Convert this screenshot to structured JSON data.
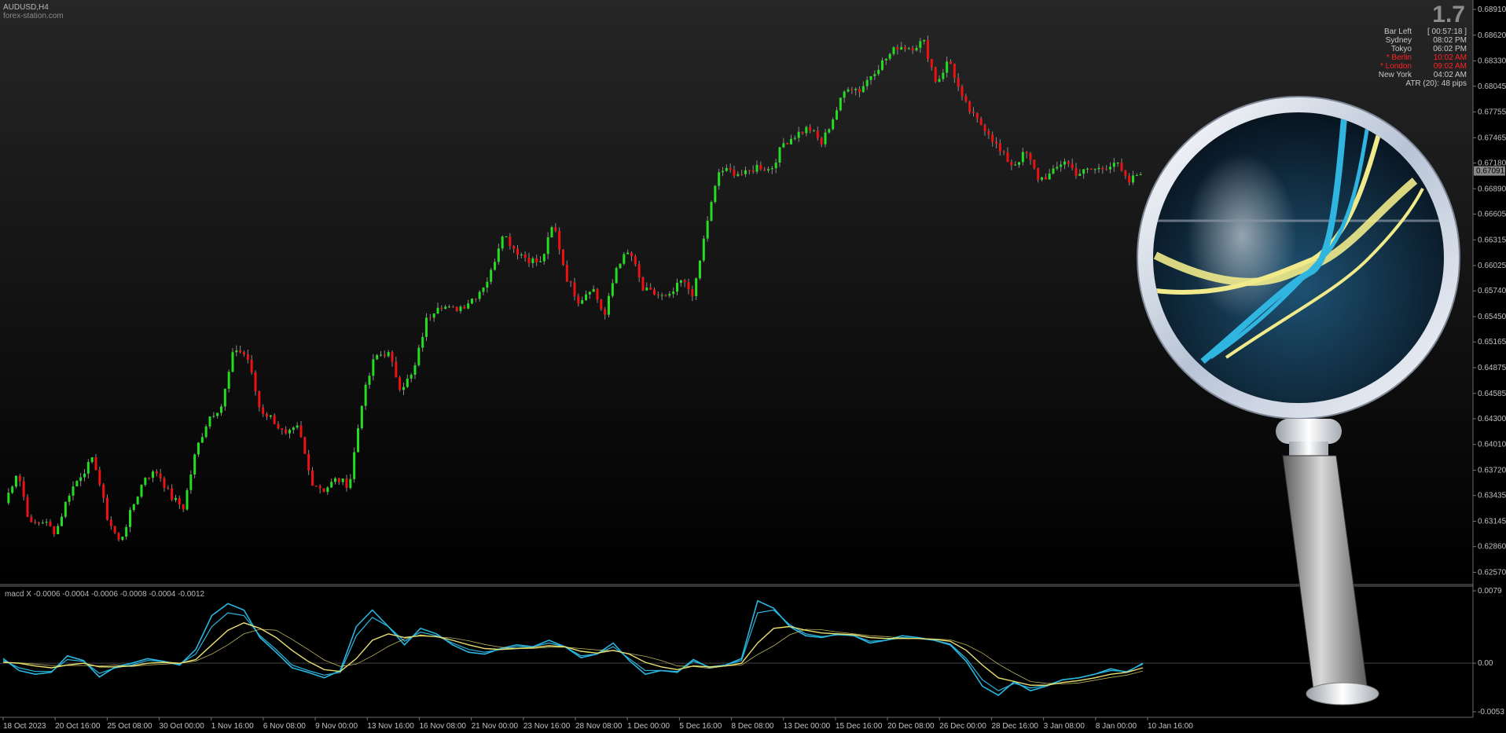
{
  "window": {
    "symbol_label": "AUDUSD,H4",
    "watermark": "forex-station.com"
  },
  "spread_value": "1.7",
  "info_panel": {
    "rows": [
      {
        "label": "Bar Left",
        "value": "[ 00:57:18 ]",
        "highlight": false
      },
      {
        "label": "Sydney",
        "value": "08:02 PM",
        "highlight": false
      },
      {
        "label": "Tokyo",
        "value": "06:02 PM",
        "highlight": false
      },
      {
        "label": "* Berlin",
        "value": "10:02 AM",
        "highlight": true
      },
      {
        "label": "* London",
        "value": "09:02 AM",
        "highlight": true
      },
      {
        "label": "New York",
        "value": "04:02 AM",
        "highlight": false
      }
    ],
    "atr_text": "ATR (20): 48 pips"
  },
  "macd_label": "macd X -0.0006 -0.0004 -0.0006 -0.0008 -0.0004 -0.0012",
  "colors": {
    "bull": "#22dd22",
    "bear": "#ee1111",
    "macd_fast": "#29b6e0",
    "macd_signal": "#e8e070",
    "grid": "#444444",
    "text": "#c0c0c0"
  },
  "chart_data": [
    {
      "type": "candlestick",
      "ylim": [
        0.6253,
        0.6891
      ],
      "y_ticks": [
        "0.68910",
        "0.68620",
        "0.68330",
        "0.68045",
        "0.67755",
        "0.67465",
        "0.67180",
        "0.66890",
        "0.66605",
        "0.66315",
        "0.66025",
        "0.65740",
        "0.65450",
        "0.65165",
        "0.64875",
        "0.64585",
        "0.64300",
        "0.64010",
        "0.63720",
        "0.63435",
        "0.63145",
        "0.62860",
        "0.62570"
      ],
      "current_price": "0.67091",
      "x_ticks": [
        "18 Oct 2023",
        "20 Oct 16:00",
        "25 Oct 08:00",
        "30 Oct 00:00",
        "1 Nov 16:00",
        "6 Nov 08:00",
        "9 Nov 00:00",
        "13 Nov 16:00",
        "16 Nov 08:00",
        "21 Nov 00:00",
        "23 Nov 16:00",
        "28 Nov 08:00",
        "1 Dec 00:00",
        "5 Dec 16:00",
        "8 Dec 08:00",
        "13 Dec 00:00",
        "15 Dec 16:00",
        "20 Dec 08:00",
        "26 Dec 00:00",
        "28 Dec 16:00",
        "3 Jan 08:00",
        "8 Jan 00:00",
        "10 Jan 16:00"
      ],
      "close_path": [
        0.6335,
        0.6372,
        0.631,
        0.6315,
        0.6302,
        0.6345,
        0.6368,
        0.6385,
        0.632,
        0.629,
        0.633,
        0.6365,
        0.637,
        0.6342,
        0.633,
        0.6395,
        0.6432,
        0.6445,
        0.651,
        0.65,
        0.644,
        0.643,
        0.641,
        0.642,
        0.636,
        0.635,
        0.6362,
        0.6355,
        0.645,
        0.65,
        0.6505,
        0.6465,
        0.648,
        0.654,
        0.656,
        0.6552,
        0.6558,
        0.657,
        0.659,
        0.664,
        0.662,
        0.661,
        0.6605,
        0.665,
        0.659,
        0.6562,
        0.658,
        0.6545,
        0.6605,
        0.6618,
        0.6575,
        0.657,
        0.6565,
        0.6585,
        0.657,
        0.665,
        0.671,
        0.6708,
        0.6705,
        0.6715,
        0.671,
        0.674,
        0.675,
        0.6758,
        0.674,
        0.6772,
        0.6805,
        0.68,
        0.682,
        0.6835,
        0.685,
        0.6848,
        0.6855,
        0.6808,
        0.6835,
        0.679,
        0.6768,
        0.6755,
        0.673,
        0.6715,
        0.673,
        0.67,
        0.6705,
        0.6722,
        0.6706,
        0.671,
        0.6712,
        0.672,
        0.6695,
        0.6709
      ]
    },
    {
      "type": "line",
      "title": "macd X",
      "ylim": [
        -0.0053,
        0.0079
      ],
      "y_ticks": [
        "0.0079",
        "0.00",
        "-0.0053"
      ],
      "series": [
        {
          "values": [
            0.0005,
            -0.0008,
            -0.0012,
            -0.001,
            0.0008,
            0.0003,
            -0.0015,
            -0.0004,
            0.0,
            0.0005,
            0.0002,
            -0.0002,
            0.0015,
            0.0052,
            0.0065,
            0.0058,
            0.0028,
            0.0012,
            -0.0005,
            -0.001,
            -0.0016,
            -0.0008,
            0.004,
            0.0058,
            0.004,
            0.002,
            0.0038,
            0.0032,
            0.002,
            0.0012,
            0.001,
            0.0016,
            0.002,
            0.0018,
            0.0025,
            0.0018,
            0.0006,
            0.001,
            0.0022,
            0.0003,
            -0.0012,
            -0.0008,
            -0.001,
            0.0004,
            -0.0005,
            -0.0002,
            0.0005,
            0.0068,
            0.006,
            0.004,
            0.003,
            0.0028,
            0.0032,
            0.003,
            0.0022,
            0.0025,
            0.003,
            0.0028,
            0.0025,
            0.002,
            0.0002,
            -0.0025,
            -0.0035,
            -0.002,
            -0.003,
            -0.0025,
            -0.0018,
            -0.0016,
            -0.0012,
            -0.0006,
            -0.001,
            0.0
          ]
        },
        {
          "values": [
            0.0003,
            -0.0005,
            -0.0009,
            -0.0009,
            0.0004,
            0.0002,
            -0.0011,
            -0.0005,
            -0.0002,
            0.0003,
            0.0002,
            -0.0001,
            0.001,
            0.004,
            0.0055,
            0.0052,
            0.003,
            0.0015,
            -0.0002,
            -0.0008,
            -0.0013,
            -0.001,
            0.003,
            0.005,
            0.004,
            0.0024,
            0.0034,
            0.003,
            0.0022,
            0.0015,
            0.0012,
            0.0015,
            0.0018,
            0.0018,
            0.0022,
            0.0018,
            0.0008,
            0.001,
            0.0018,
            0.0005,
            -0.0008,
            -0.0008,
            -0.0009,
            0.0002,
            -0.0004,
            -0.0002,
            0.0003,
            0.0055,
            0.0058,
            0.0042,
            0.0032,
            0.0029,
            0.0031,
            0.003,
            0.0024,
            0.0025,
            0.0028,
            0.0027,
            0.0025,
            0.0021,
            0.0005,
            -0.0018,
            -0.003,
            -0.0022,
            -0.0027,
            -0.0024,
            -0.0018,
            -0.0016,
            -0.0012,
            -0.0008,
            -0.0009,
            -0.0001
          ]
        },
        {
          "values": [
            0.0001,
            0.0,
            -0.0003,
            -0.0005,
            -0.0002,
            0.0,
            -0.0004,
            -0.0004,
            -0.0003,
            0.0,
            0.0001,
            0.0,
            0.0004,
            0.002,
            0.0036,
            0.0044,
            0.0038,
            0.0028,
            0.0014,
            0.0002,
            -0.0007,
            -0.0009,
            0.0005,
            0.0025,
            0.0032,
            0.0028,
            0.003,
            0.0029,
            0.0025,
            0.002,
            0.0016,
            0.0015,
            0.0016,
            0.0017,
            0.0019,
            0.0018,
            0.0013,
            0.0011,
            0.0014,
            0.001,
            0.0001,
            -0.0004,
            -0.0007,
            -0.0003,
            -0.0004,
            -0.0003,
            0.0,
            0.0022,
            0.0038,
            0.004,
            0.0036,
            0.0033,
            0.0032,
            0.0031,
            0.0028,
            0.0027,
            0.0027,
            0.0027,
            0.0026,
            0.0024,
            0.0014,
            -0.0002,
            -0.0016,
            -0.002,
            -0.0024,
            -0.0024,
            -0.0021,
            -0.0019,
            -0.0016,
            -0.0012,
            -0.001,
            -0.0005
          ]
        }
      ]
    }
  ]
}
